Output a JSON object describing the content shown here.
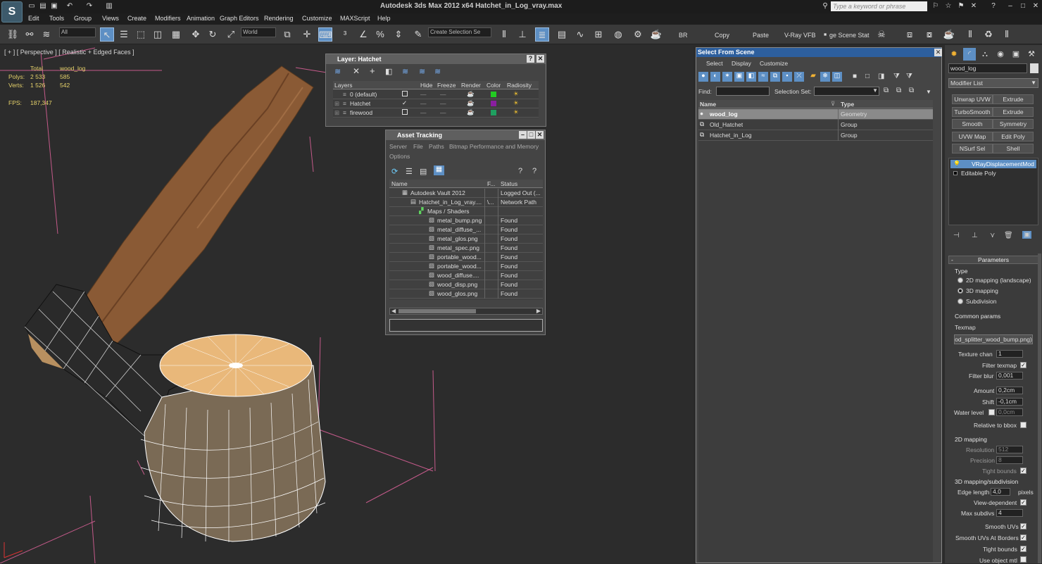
{
  "window": {
    "title": "Autodesk 3ds Max  2012 x64     Hatchet_in_Log_vray.max",
    "logo": "S",
    "search_placeholder": "Type a keyword or phrase"
  },
  "menu": [
    "Edit",
    "Tools",
    "Group",
    "Views",
    "Create",
    "Modifiers",
    "Animation",
    "Graph Editors",
    "Rendering",
    "Customize",
    "MAXScript",
    "Help"
  ],
  "toolbar": {
    "filter_value": "All",
    "coord_value": "World",
    "selection_set_placeholder": "Create Selection Se",
    "br_label": "BR",
    "copy_label": "Copy",
    "paste_label": "Paste",
    "vray_vfb_label": "V-Ray VFB",
    "scene_states_label": "ge Scene Stat"
  },
  "viewport": {
    "label": "[ + ] [ Perspective ] [ Realistic + Edged Faces ]",
    "stats": {
      "total_label": "Total",
      "object_label": "wood_log",
      "polys_label": "Polys:",
      "polys_total": "2 533",
      "polys_object": "585",
      "verts_label": "Verts:",
      "verts_total": "1 526",
      "verts_object": "542",
      "fps_label": "FPS:",
      "fps_value": "187,347"
    }
  },
  "layer_dialog": {
    "title": "Layer: Hatchet",
    "columns": [
      "Layers",
      "Hide",
      "Freeze",
      "Render",
      "Color",
      "Radiosity"
    ],
    "rows": [
      {
        "name": "0 (default)",
        "color": "#22cc22"
      },
      {
        "name": "Hatchet",
        "color": "#8a1ea0"
      },
      {
        "name": "firewood",
        "color": "#1fa060"
      }
    ]
  },
  "asset_tracking": {
    "title": "Asset Tracking",
    "menu": [
      "Server",
      "File",
      "Paths",
      "Bitmap Performance and Memory",
      "Options"
    ],
    "columns": [
      "Name",
      "F...",
      "Status"
    ],
    "rows": [
      {
        "name": "Autodesk Vault 2012",
        "f": "",
        "status": "Logged Out (..."
      },
      {
        "name": "Hatchet_in_Log_vray....",
        "f": "\\...",
        "status": "Network Path"
      },
      {
        "name": "Maps / Shaders",
        "f": "",
        "status": ""
      },
      {
        "name": "metal_bump.png",
        "f": "",
        "status": "Found"
      },
      {
        "name": "metal_diffuse_...",
        "f": "",
        "status": "Found"
      },
      {
        "name": "metal_glos.png",
        "f": "",
        "status": "Found"
      },
      {
        "name": "metal_spec.png",
        "f": "",
        "status": "Found"
      },
      {
        "name": "portable_wood...",
        "f": "",
        "status": "Found"
      },
      {
        "name": "portable_wood...",
        "f": "",
        "status": "Found"
      },
      {
        "name": "wood_diffuse....",
        "f": "",
        "status": "Found"
      },
      {
        "name": "wood_disp.png",
        "f": "",
        "status": "Found"
      },
      {
        "name": "wood_glos.png",
        "f": "",
        "status": "Found"
      }
    ]
  },
  "select_from_scene": {
    "title": "Select From Scene",
    "menu": [
      "Select",
      "Display",
      "Customize"
    ],
    "find_label": "Find:",
    "selection_set_label": "Selection Set:",
    "columns": [
      "Name",
      "Type"
    ],
    "rows": [
      {
        "name": "wood_log",
        "type": "Geometry",
        "selected": true
      },
      {
        "name": "Old_Hatchet",
        "type": "Group",
        "selected": false
      },
      {
        "name": "Hatchet_in_Log",
        "type": "Group",
        "selected": false
      }
    ]
  },
  "command_panel": {
    "object_name": "wood_log",
    "modifier_list_label": "Modifier List",
    "modifier_buttons": [
      "Unwrap UVW",
      "Extrude",
      "TurboSmooth",
      "Extrude",
      "Smooth",
      "Symmetry",
      "UVW Map",
      "Edit Poly",
      "NSurf Sel",
      "Shell"
    ],
    "stack": [
      {
        "name": "VRayDisplacementMod",
        "selected": true
      },
      {
        "name": "Editable Poly",
        "selected": false
      }
    ],
    "parameters": {
      "rollout_title": "Parameters",
      "type_label": "Type",
      "type_options": [
        "2D mapping (landscape)",
        "3D mapping",
        "Subdivision"
      ],
      "type_selected": 1,
      "common_label": "Common params",
      "texmap_label": "Texmap",
      "texmap_value": "od_splitter_wood_bump.png)",
      "texture_chan_label": "Texture chan",
      "texture_chan_value": "1",
      "filter_texmap_label": "Filter texmap",
      "filter_blur_label": "Filter blur",
      "filter_blur_value": "0,001",
      "amount_label": "Amount",
      "amount_value": "0,2cm",
      "shift_label": "Shift",
      "shift_value": "-0,1cm",
      "water_level_label": "Water level",
      "water_level_value": "0,0cm",
      "relative_bbox_label": "Relative to bbox",
      "mapping2d_label": "2D mapping",
      "resolution_label": "Resolution",
      "resolution_value": "512",
      "precision_label": "Precision",
      "precision_value": "8",
      "tight_bounds_label": "Tight bounds",
      "mapping3d_label": "3D mapping/subdivision",
      "edge_length_label": "Edge length",
      "edge_length_value": "4,0",
      "pixels_label": "pixels",
      "view_dependent_label": "View-dependent",
      "max_subdivs_label": "Max subdivs",
      "max_subdivs_value": "4",
      "smooth_uvs_label": "Smooth UVs",
      "smooth_uvs_borders_label": "Smooth UVs At Borders",
      "tight_bounds2_label": "Tight bounds",
      "use_object_mtl_label": "Use object mtl"
    }
  }
}
